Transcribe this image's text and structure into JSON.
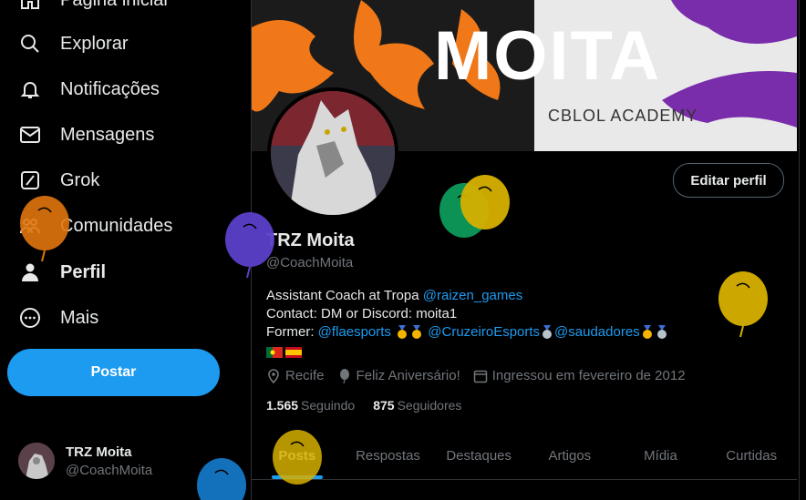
{
  "sidebar": {
    "items": [
      {
        "label": "Página inicial",
        "icon": "home-icon"
      },
      {
        "label": "Explorar",
        "icon": "search-icon"
      },
      {
        "label": "Notificações",
        "icon": "bell-icon"
      },
      {
        "label": "Mensagens",
        "icon": "mail-icon"
      },
      {
        "label": "Grok",
        "icon": "grok-icon"
      },
      {
        "label": "Comunidades",
        "icon": "communities-icon"
      },
      {
        "label": "Perfil",
        "icon": "person-icon"
      },
      {
        "label": "Mais",
        "icon": "more-circle-icon"
      }
    ],
    "post_button": "Postar",
    "account": {
      "name": "TRZ Moita",
      "handle": "@CoachMoita"
    }
  },
  "banner": {
    "title": "MOITA",
    "subtitle": "CBLOL ACADEMY"
  },
  "profile": {
    "edit_button": "Editar perfil",
    "name": "TRZ Moita",
    "handle": "@CoachMoita",
    "bio": {
      "line1_text": "Assistant Coach at Tropa ",
      "line1_link": "@raizen_games",
      "line2": "Contact: DM or Discord: moita1",
      "line3_prefix": "Former: ",
      "links": [
        "@flaesports",
        "@CruzeiroEsports",
        "@saudadores"
      ]
    },
    "location": "Recife",
    "birthday": "Feliz Aniversário!",
    "joined": "Ingressou em fevereiro de 2012",
    "following_count": "1.565",
    "following_label": "Seguindo",
    "followers_count": "875",
    "followers_label": "Seguidores"
  },
  "tabs": [
    "Posts",
    "Respostas",
    "Destaques",
    "Artigos",
    "Mídia",
    "Curtidas"
  ],
  "colors": {
    "accent": "#1d9bf0",
    "bg": "#000000",
    "muted": "#71767b"
  }
}
